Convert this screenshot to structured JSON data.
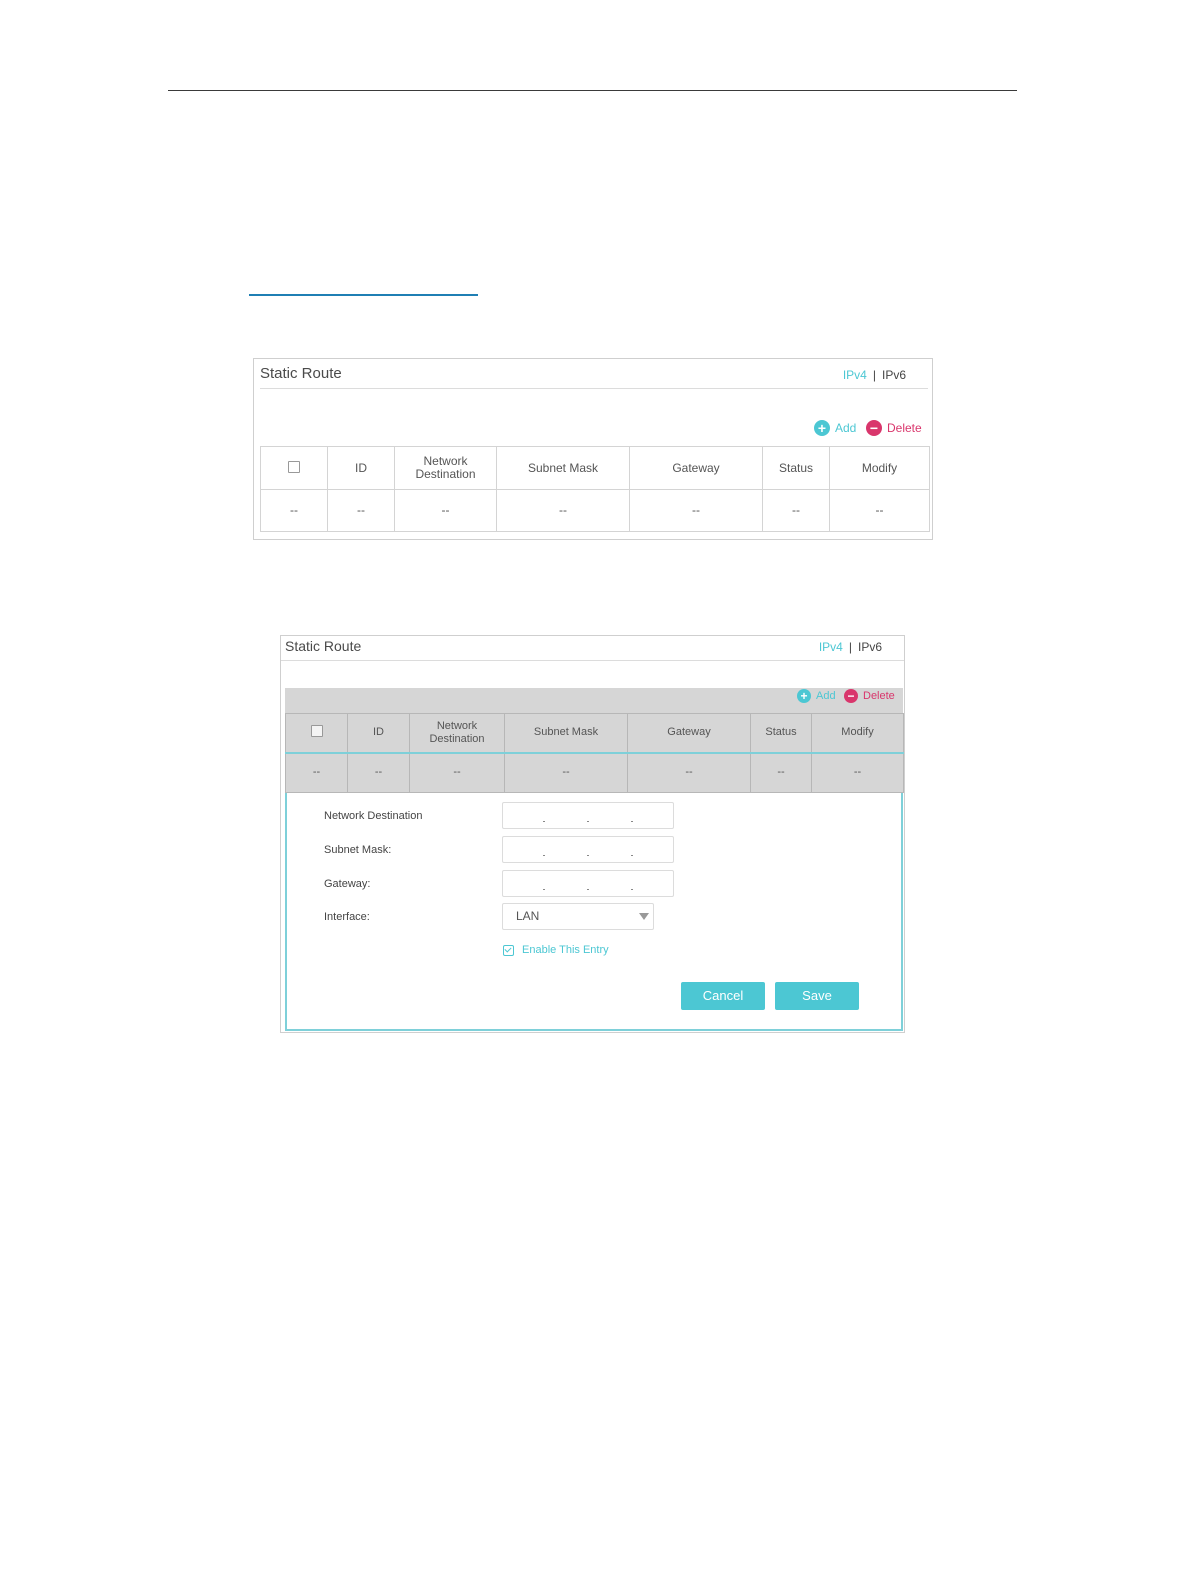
{
  "panel1": {
    "title": "Static Route",
    "ipv4": "IPv4",
    "separator": "|",
    "ipv6": "IPv6",
    "add_label": "Add",
    "delete_label": "Delete",
    "columns": [
      "",
      "ID",
      "Network Destination",
      "Subnet Mask",
      "Gateway",
      "Status",
      "Modify"
    ],
    "row": [
      "--",
      "--",
      "--",
      "--",
      "--",
      "--",
      "--"
    ]
  },
  "panel2": {
    "title": "Static Route",
    "ipv4": "IPv4",
    "separator": "|",
    "ipv6": "IPv6",
    "add_label": "Add",
    "delete_label": "Delete",
    "columns": [
      "",
      "ID",
      "Network Destination",
      "Subnet Mask",
      "Gateway",
      "Status",
      "Modify"
    ],
    "row": [
      "--",
      "--",
      "--",
      "--",
      "--",
      "--",
      "--"
    ],
    "form": {
      "network_destination_label": "Network Destination",
      "subnet_mask_label": "Subnet Mask:",
      "gateway_label": "Gateway:",
      "interface_label": "Interface:",
      "interface_value": "LAN",
      "enable_label": "Enable This Entry",
      "cancel_label": "Cancel",
      "save_label": "Save"
    }
  },
  "colors": {
    "accent": "#4cc7d3",
    "delete": "#d9366c",
    "rule_blue": "#1f7fb4"
  }
}
